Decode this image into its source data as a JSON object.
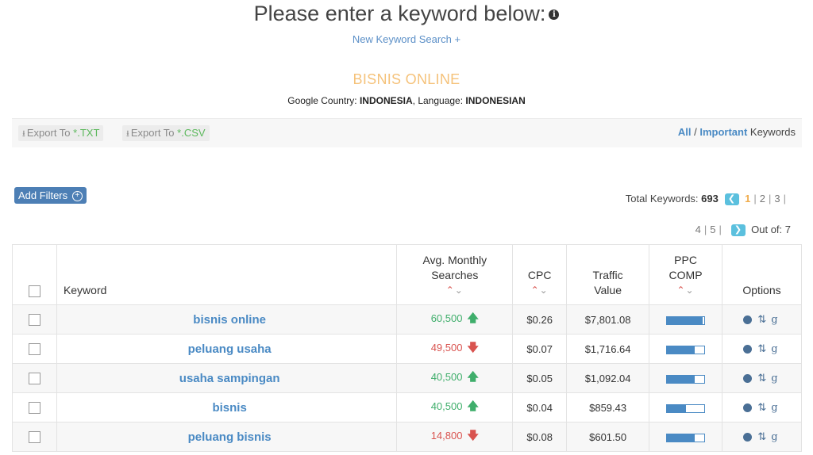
{
  "header": {
    "title": "Please enter a keyword below:",
    "new_search": "New Keyword Search +",
    "keyword": "BISNIS ONLINE",
    "country_label": "Google Country:",
    "country": "INDONESIA",
    "language_label": ", Language:",
    "language": "INDONESIAN"
  },
  "toolbar": {
    "export_txt_prefix": "Export To ",
    "export_txt_ext": "*.TXT",
    "export_csv_prefix": "Export To ",
    "export_csv_ext": "*.CSV",
    "all_label": "All",
    "slash": " / ",
    "important_label": "Important",
    "keywords_suffix": " Keywords"
  },
  "filters": {
    "add_label": "Add Filters"
  },
  "pagination": {
    "total_label": "Total Keywords:",
    "total": "693",
    "current": "1",
    "pages_row1": [
      "2",
      "3"
    ],
    "pages_row2": [
      "4",
      "5"
    ],
    "out_of_label": "Out of: 7"
  },
  "table": {
    "headers": {
      "keyword": "Keyword",
      "avg_monthly_line1": "Avg. Monthly",
      "avg_monthly_line2": "Searches",
      "cpc": "CPC",
      "traffic_line1": "Traffic",
      "traffic_line2": "Value",
      "ppc_line1": "PPC",
      "ppc_line2": "COMP",
      "options": "Options"
    },
    "rows": [
      {
        "keyword": "bisnis online",
        "searches": "60,500",
        "trend": "up",
        "cpc": "$0.26",
        "traffic": "$7,801.08",
        "ppc_comp": 0.95
      },
      {
        "keyword": "peluang usaha",
        "searches": "49,500",
        "trend": "down",
        "cpc": "$0.07",
        "traffic": "$1,716.64",
        "ppc_comp": 0.75
      },
      {
        "keyword": "usaha sampingan",
        "searches": "40,500",
        "trend": "up",
        "cpc": "$0.05",
        "traffic": "$1,092.04",
        "ppc_comp": 0.75
      },
      {
        "keyword": "bisnis",
        "searches": "40,500",
        "trend": "up",
        "cpc": "$0.04",
        "traffic": "$859.43",
        "ppc_comp": 0.5
      },
      {
        "keyword": "peluang bisnis",
        "searches": "14,800",
        "trend": "down",
        "cpc": "$0.08",
        "traffic": "$601.50",
        "ppc_comp": 0.75
      }
    ]
  },
  "icons": {
    "info": "info-circle-icon",
    "download": "download-icon",
    "add": "plus-circle-icon",
    "prev": "chevron-left-icon",
    "next": "chevron-right-icon",
    "sort_up": "chevron-up-icon",
    "sort_down": "chevron-down-icon",
    "trend_up": "arrow-up-icon",
    "trend_down": "arrow-down-icon",
    "globe": "globe-icon",
    "sort_az": "sort-alpha-icon",
    "google": "google-icon"
  },
  "colors": {
    "link": "#4a8ac4",
    "keyword_title": "#f5c27a",
    "trend_up": "#3fae6b",
    "trend_down": "#d9534f",
    "pager_current": "#f0ad4e",
    "pager_arrow": "#5bc0de",
    "filter_button": "#4d7fb5"
  }
}
